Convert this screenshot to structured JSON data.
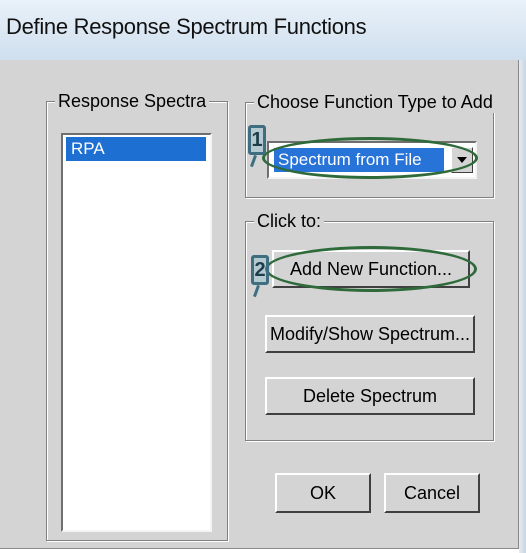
{
  "window": {
    "title": "Define Response Spectrum Functions"
  },
  "response_spectra": {
    "legend": "Response Spectra",
    "items": [
      "RPA"
    ],
    "selected": "RPA"
  },
  "function_type": {
    "legend": "Choose  Function Type to Add",
    "selected": "Spectrum from File"
  },
  "click_to": {
    "legend": "Click to:",
    "add_label": "Add New Function...",
    "modify_label": "Modify/Show Spectrum...",
    "delete_label": "Delete Spectrum"
  },
  "footer": {
    "ok_label": "OK",
    "cancel_label": "Cancel"
  },
  "annotations": {
    "marker_1": "1",
    "marker_2": "2",
    "highlight_color": "#2f6a3a",
    "marker_color": "#3f6e80"
  },
  "colors": {
    "selection": "#1e6fd2",
    "dialog_bg": "#d4d4d4"
  }
}
